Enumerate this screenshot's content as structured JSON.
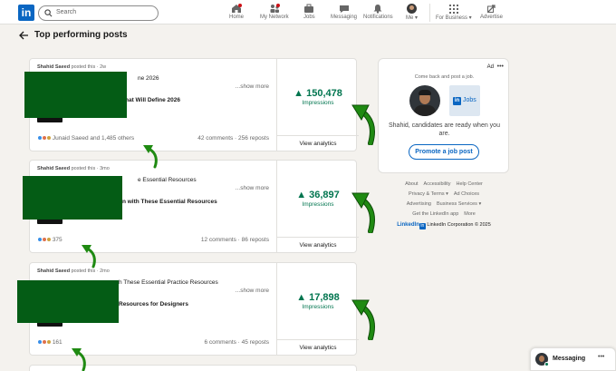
{
  "nav": {
    "logo": "in",
    "search_placeholder": "Search",
    "items": [
      {
        "label": "Home",
        "icon": "home-icon",
        "badge": "1"
      },
      {
        "label": "My Network",
        "icon": "network-icon",
        "badge": "1"
      },
      {
        "label": "Jobs",
        "icon": "jobs-icon"
      },
      {
        "label": "Messaging",
        "icon": "messaging-icon"
      },
      {
        "label": "Notifications",
        "icon": "bell-icon"
      },
      {
        "label": "Me ▾",
        "icon": "avatar"
      },
      {
        "label": "For Business ▾",
        "icon": "grid-icon"
      },
      {
        "label": "Advertise",
        "icon": "advertise-icon"
      }
    ]
  },
  "page": {
    "title": "Top performing posts"
  },
  "posts": [
    {
      "poster": "Shahid Saeed",
      "posted_suffix": " posted this · 2w",
      "line1": "ne 2026",
      "line2": "hat Will Define 2026",
      "show_more": "...show more",
      "reactions_text": "Junaid Saeed and 1,485 others",
      "stats": "42 comments · 256 reposts",
      "impressions": "150,478",
      "impressions_label": "Impressions",
      "view_analytics": "View analytics"
    },
    {
      "poster": "Shahid Saeed",
      "posted_suffix": " posted this · 3mo",
      "line1": "e Essential Resources",
      "line2": "gn with These Essential Resources",
      "show_more": "...show more",
      "reactions_text": "375",
      "stats": "12 comments · 86 reposts",
      "impressions": "36,897",
      "impressions_label": "Impressions",
      "view_analytics": "View analytics"
    },
    {
      "poster": "Shahid Saeed",
      "posted_suffix": " posted this · 2mo",
      "line1": "h These Essential Practice Resources",
      "line2": "Resources for Designers",
      "show_more": "...show more",
      "reactions_text": "161",
      "stats": "6 comments · 45 reposts",
      "impressions": "17,898",
      "impressions_label": "Impressions",
      "view_analytics": "View analytics"
    }
  ],
  "ad": {
    "label": "Ad",
    "tagline": "Come back and post a job.",
    "jobs_logo": "Jobs",
    "message": "Shahid, candidates are ready when you are.",
    "cta": "Promote a job post"
  },
  "footer": {
    "row1": [
      "About",
      "Accessibility",
      "Help Center"
    ],
    "row2": [
      "Privacy & Terms ▾",
      "Ad Choices"
    ],
    "row3": [
      "Advertising",
      "Business Services ▾"
    ],
    "row4": [
      "Get the LinkedIn app",
      "More"
    ],
    "brand": "LinkedIn",
    "copyright": "LinkedIn Corporation © 2025"
  },
  "messaging": {
    "label": "Messaging"
  },
  "colors": {
    "brand": "#0a66c2",
    "impressions": "#01754f",
    "annotation_arrow": "#1f8a12",
    "redaction": "#045c15"
  }
}
